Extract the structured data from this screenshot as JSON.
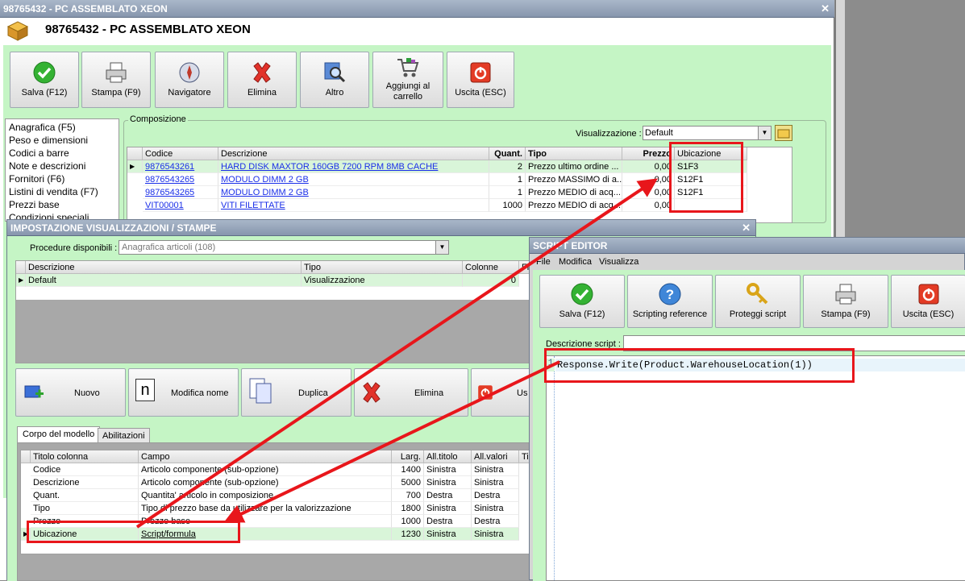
{
  "main_window": {
    "titlebar": "98765432 - PC ASSEMBLATO XEON",
    "heading": "98765432 - PC ASSEMBLATO XEON",
    "toolbar": [
      {
        "label": "Salva (F12)",
        "icon": "check-icon"
      },
      {
        "label": "Stampa (F9)",
        "icon": "printer-icon"
      },
      {
        "label": "Navigatore",
        "icon": "compass-icon"
      },
      {
        "label": "Elimina",
        "icon": "delete-x-icon"
      },
      {
        "label": "Altro",
        "icon": "magnifier-icon"
      },
      {
        "label": "Aggiungi al carrello",
        "icon": "cart-icon"
      },
      {
        "label": "Uscita (ESC)",
        "icon": "exit-icon"
      }
    ],
    "sidebar": [
      "Anagrafica (F5)",
      "Peso e dimensioni",
      "Codici a barre",
      "Note e descrizioni",
      "Fornitori (F6)",
      "Listini di vendita (F7)",
      "Prezzi base",
      "Condizioni speciali"
    ],
    "composizione": {
      "group_label": "Composizione",
      "view_label": "Visualizzazione :",
      "view_value": "Default",
      "headers": [
        "Codice",
        "Descrizione",
        "Quant.",
        "Tipo",
        "Prezzo",
        "Ubicazione"
      ],
      "rows": [
        [
          "9876543261",
          "HARD DISK MAXTOR 160GB 7200 RPM 8MB CACHE",
          "2",
          "Prezzo ultimo ordine ...",
          "0,00",
          "S1F3"
        ],
        [
          "9876543265",
          "MODULO DIMM 2 GB",
          "1",
          "Prezzo MASSIMO di a...",
          "0,00",
          "S12F1"
        ],
        [
          "9876543265",
          "MODULO DIMM 2 GB",
          "1",
          "Prezzo MEDIO di acq...",
          "0,00",
          "S12F1"
        ],
        [
          "VIT00001",
          "VITI FILETTATE",
          "1000",
          "Prezzo MEDIO di acq...",
          "0,00",
          ""
        ]
      ]
    }
  },
  "imp_window": {
    "title": "IMPOSTAZIONE VISUALIZZAZIONI / STAMPE",
    "procedure_label": "Procedure disponibili :",
    "procedure_value": "Anagrafica articoli (108)",
    "grid_headers": [
      "Descrizione",
      "Tipo",
      "Colonne",
      "Fil"
    ],
    "grid_rows": [
      [
        "Default",
        "Visualizzazione",
        "0",
        ""
      ]
    ],
    "buttons": [
      {
        "label": "Nuovo",
        "icon": "new-icon"
      },
      {
        "label": "Modifica nome",
        "icon": "rename-icon"
      },
      {
        "label": "Duplica",
        "icon": "duplicate-icon"
      },
      {
        "label": "Elimina",
        "icon": "delete-x-icon"
      },
      {
        "label": "Us",
        "icon": "exit-icon"
      }
    ],
    "tabs": [
      "Corpo del modello",
      "Abilitazioni"
    ],
    "body_headers": [
      "Titolo colonna",
      "Campo",
      "Larg.",
      "All.titolo",
      "All.valori",
      "Ti"
    ],
    "body_rows": [
      [
        "Codice",
        "Articolo componente (sub-opzione)",
        "1400",
        "Sinistra",
        "Sinistra"
      ],
      [
        "Descrizione",
        "Articolo componente (sub-opzione)",
        "5000",
        "Sinistra",
        "Sinistra"
      ],
      [
        "Quant.",
        "Quantita' articolo in composizione",
        "700",
        "Destra",
        "Destra"
      ],
      [
        "Tipo",
        "Tipo di prezzo base da utilizzare per la valorizzazione",
        "1800",
        "Sinistra",
        "Sinistra"
      ],
      [
        "Prezzo",
        "Prezzo base",
        "1000",
        "Destra",
        "Destra"
      ],
      [
        "Ubicazione",
        "Script/formula",
        "1230",
        "Sinistra",
        "Sinistra"
      ]
    ]
  },
  "script_editor": {
    "title": "SCRIPT EDITOR",
    "menu": [
      "File",
      "Modifica",
      "Visualizza"
    ],
    "toolbar": [
      {
        "label": "Salva (F12)",
        "icon": "check-icon"
      },
      {
        "label": "Scripting reference",
        "icon": "help-icon"
      },
      {
        "label": "Proteggi script",
        "icon": "key-icon"
      },
      {
        "label": "Stampa (F9)",
        "icon": "printer-icon"
      },
      {
        "label": "Uscita (ESC)",
        "icon": "exit-icon"
      }
    ],
    "desc_label": "Descrizione script :",
    "line_number": "1",
    "code": "Response.Write(Product.WarehouseLocation(1))"
  },
  "colors": {
    "accent_green": "#c5f5c5",
    "selection": "#d9f5d9",
    "annotation_red": "#e8161b"
  }
}
